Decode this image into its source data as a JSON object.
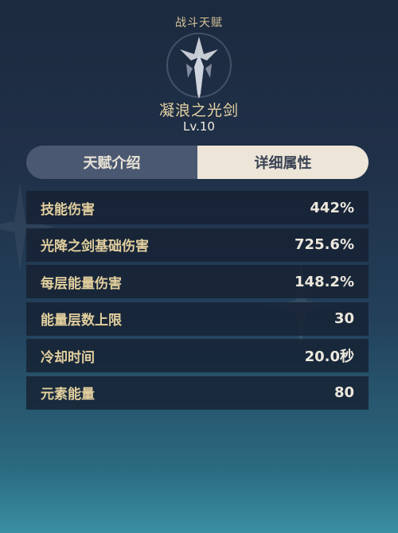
{
  "header": {
    "category": "战斗天赋"
  },
  "skill": {
    "name": "凝浪之光剑",
    "level": "Lv.10",
    "emblem_icon": "light-sword-icon"
  },
  "tabs": [
    {
      "label": "天赋介绍",
      "active": false
    },
    {
      "label": "详细属性",
      "active": true
    }
  ],
  "stats": [
    {
      "label": "技能伤害",
      "value": "442%"
    },
    {
      "label": "光降之剑基础伤害",
      "value": "725.6%"
    },
    {
      "label": "每层能量伤害",
      "value": "148.2%"
    },
    {
      "label": "能量层数上限",
      "value": "30"
    },
    {
      "label": "冷却时间",
      "value": "20.0秒"
    },
    {
      "label": "元素能量",
      "value": "80"
    }
  ],
  "colors": {
    "label_gold": "#e2cf9e",
    "value_white": "#ece8dc",
    "tab_active_bg": "#ece5d8",
    "tab_inactive_bg": "#4b5872"
  }
}
